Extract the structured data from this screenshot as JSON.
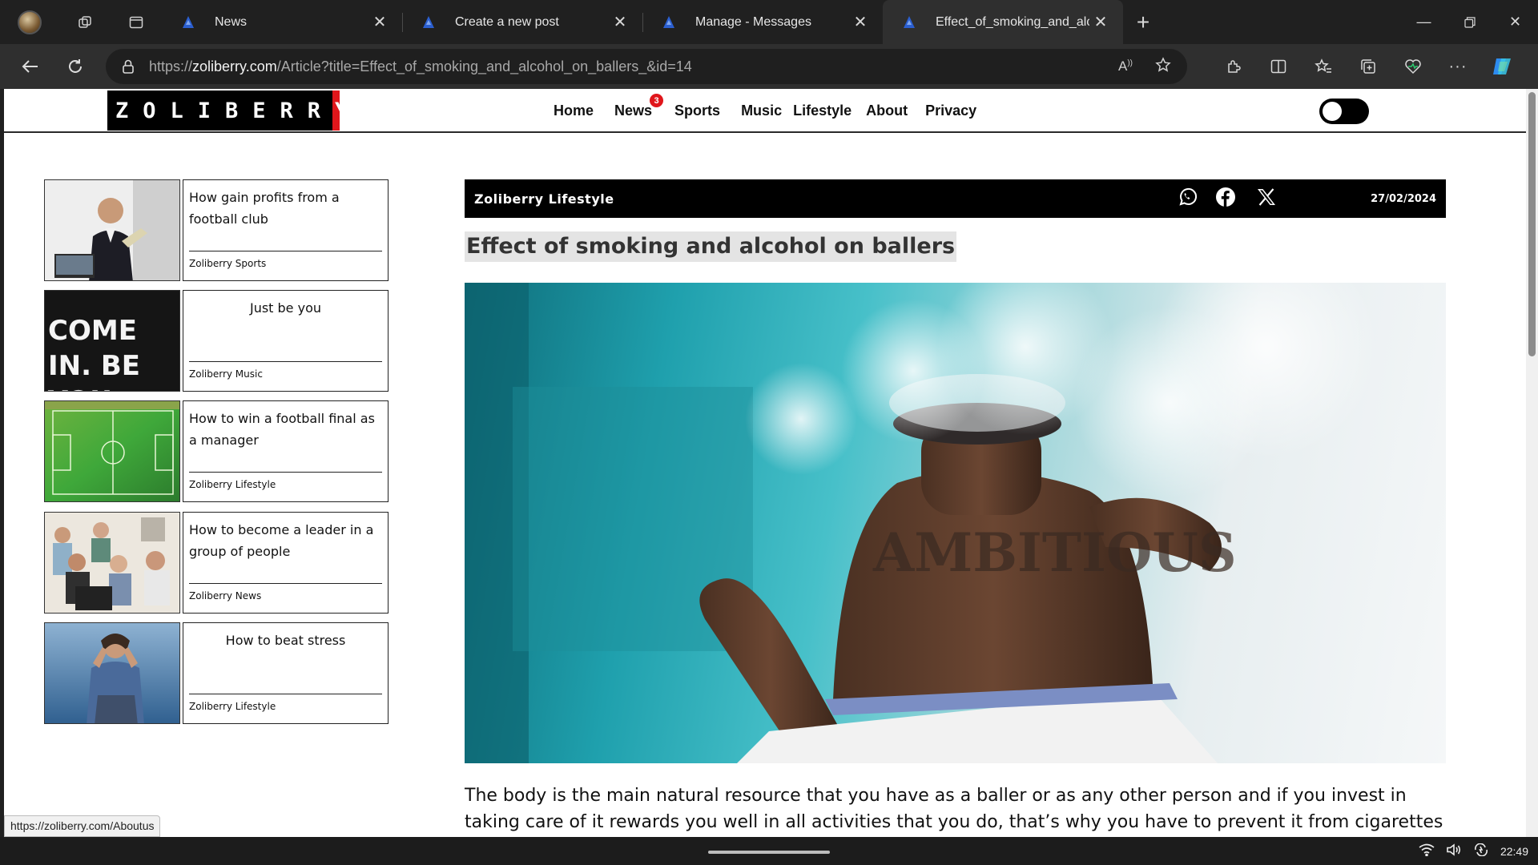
{
  "browser": {
    "tabs": [
      {
        "title": "News",
        "active": false
      },
      {
        "title": "Create a new post",
        "active": false
      },
      {
        "title": "Manage - Messages",
        "active": false
      },
      {
        "title": "Effect_of_smoking_and_alco",
        "active": true
      }
    ],
    "url_prefix": "https://",
    "url_domain": "zoliberry.com",
    "url_path": "/Article?title=Effect_of_smoking_and_alcohol_on_ballers_&id=14",
    "accent_color": "#1e3a8a"
  },
  "site": {
    "logo": "ZOLIBERRY",
    "nav": [
      {
        "label": "Home"
      },
      {
        "label": "News",
        "badge": "3"
      },
      {
        "label": "Sports"
      },
      {
        "label": "Music"
      },
      {
        "label": "Lifestyle"
      },
      {
        "label": "About"
      },
      {
        "label": "Privacy"
      }
    ],
    "brand_colors": {
      "logo_bg": "#000000",
      "logo_accent": "#e0161b"
    }
  },
  "sidebar": {
    "cards": [
      {
        "title": "How gain profits from a football club",
        "category": "Zoliberry Sports"
      },
      {
        "title": "Just be you",
        "category": "Zoliberry Music",
        "image_text": "COME IN. BE YOU."
      },
      {
        "title": "How to win a football final as a manager",
        "category": "Zoliberry Lifestyle"
      },
      {
        "title": "How to become a leader in a group of people",
        "category": "Zoliberry News"
      },
      {
        "title": "How to beat stress",
        "category": "Zoliberry Lifestyle"
      }
    ]
  },
  "article": {
    "category": "Zoliberry Lifestyle",
    "date": "27/02/2024",
    "share_icons": [
      "whatsapp-icon",
      "facebook-icon",
      "x-icon"
    ],
    "title": "Effect of smoking and alcohol on ballers",
    "hero_text": "AMBITIOUS",
    "body": "The body is the main natural resource that you have as a baller or as any other person and if you invest in taking care of it rewards you well in all activities that you do, that’s why you have to prevent it from cigarettes or alcohol as they"
  },
  "status_url": "https://zoliberry.com/Aboutus",
  "taskbar": {
    "time": "22:49"
  }
}
